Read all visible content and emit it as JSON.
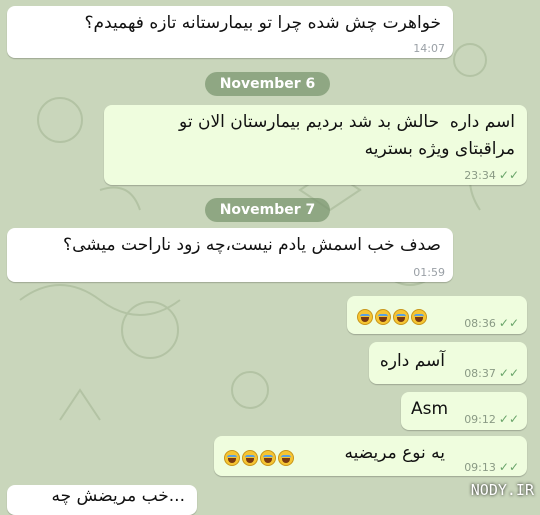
{
  "chat": {
    "messages": [
      {
        "text": "خواهرت چش شده چرا تو بیمارستانه تازه فهمیدم؟",
        "time": "14:07"
      },
      {
        "text": "اسم داره  حالش بد شد بردیم بیمارستان الان تو\nمراقبتای ویژه بستریه",
        "time": "23:34",
        "status": "read"
      },
      {
        "text": "صدف خب اسمش یادم نیست،چه زود ناراحت میشی؟",
        "time": "01:59"
      },
      {
        "emoji": "face-with-tears-of-joy",
        "emoji_count": 4,
        "time": "08:36",
        "status": "read"
      },
      {
        "text": "آسم داره",
        "time": "08:37",
        "status": "read"
      },
      {
        "text": "Asm",
        "time": "09:12",
        "status": "read"
      },
      {
        "text": "یه نوع مریضیه",
        "emoji": "face-with-tears-of-joy",
        "emoji_count": 4,
        "time": "09:13",
        "status": "read"
      },
      {
        "text": "...خب مریضش چه"
      }
    ],
    "dates": [
      "November 6",
      "November 7"
    ]
  },
  "icons": {
    "read_check": "double-check-icon",
    "laugh": "face-with-tears-of-joy"
  },
  "watermark": "NODY.IR",
  "colors": {
    "wallpaper": "#c9d6bb",
    "incoming": "#ffffff",
    "outgoing": "#effdde",
    "date_pill": "#7a946e"
  }
}
